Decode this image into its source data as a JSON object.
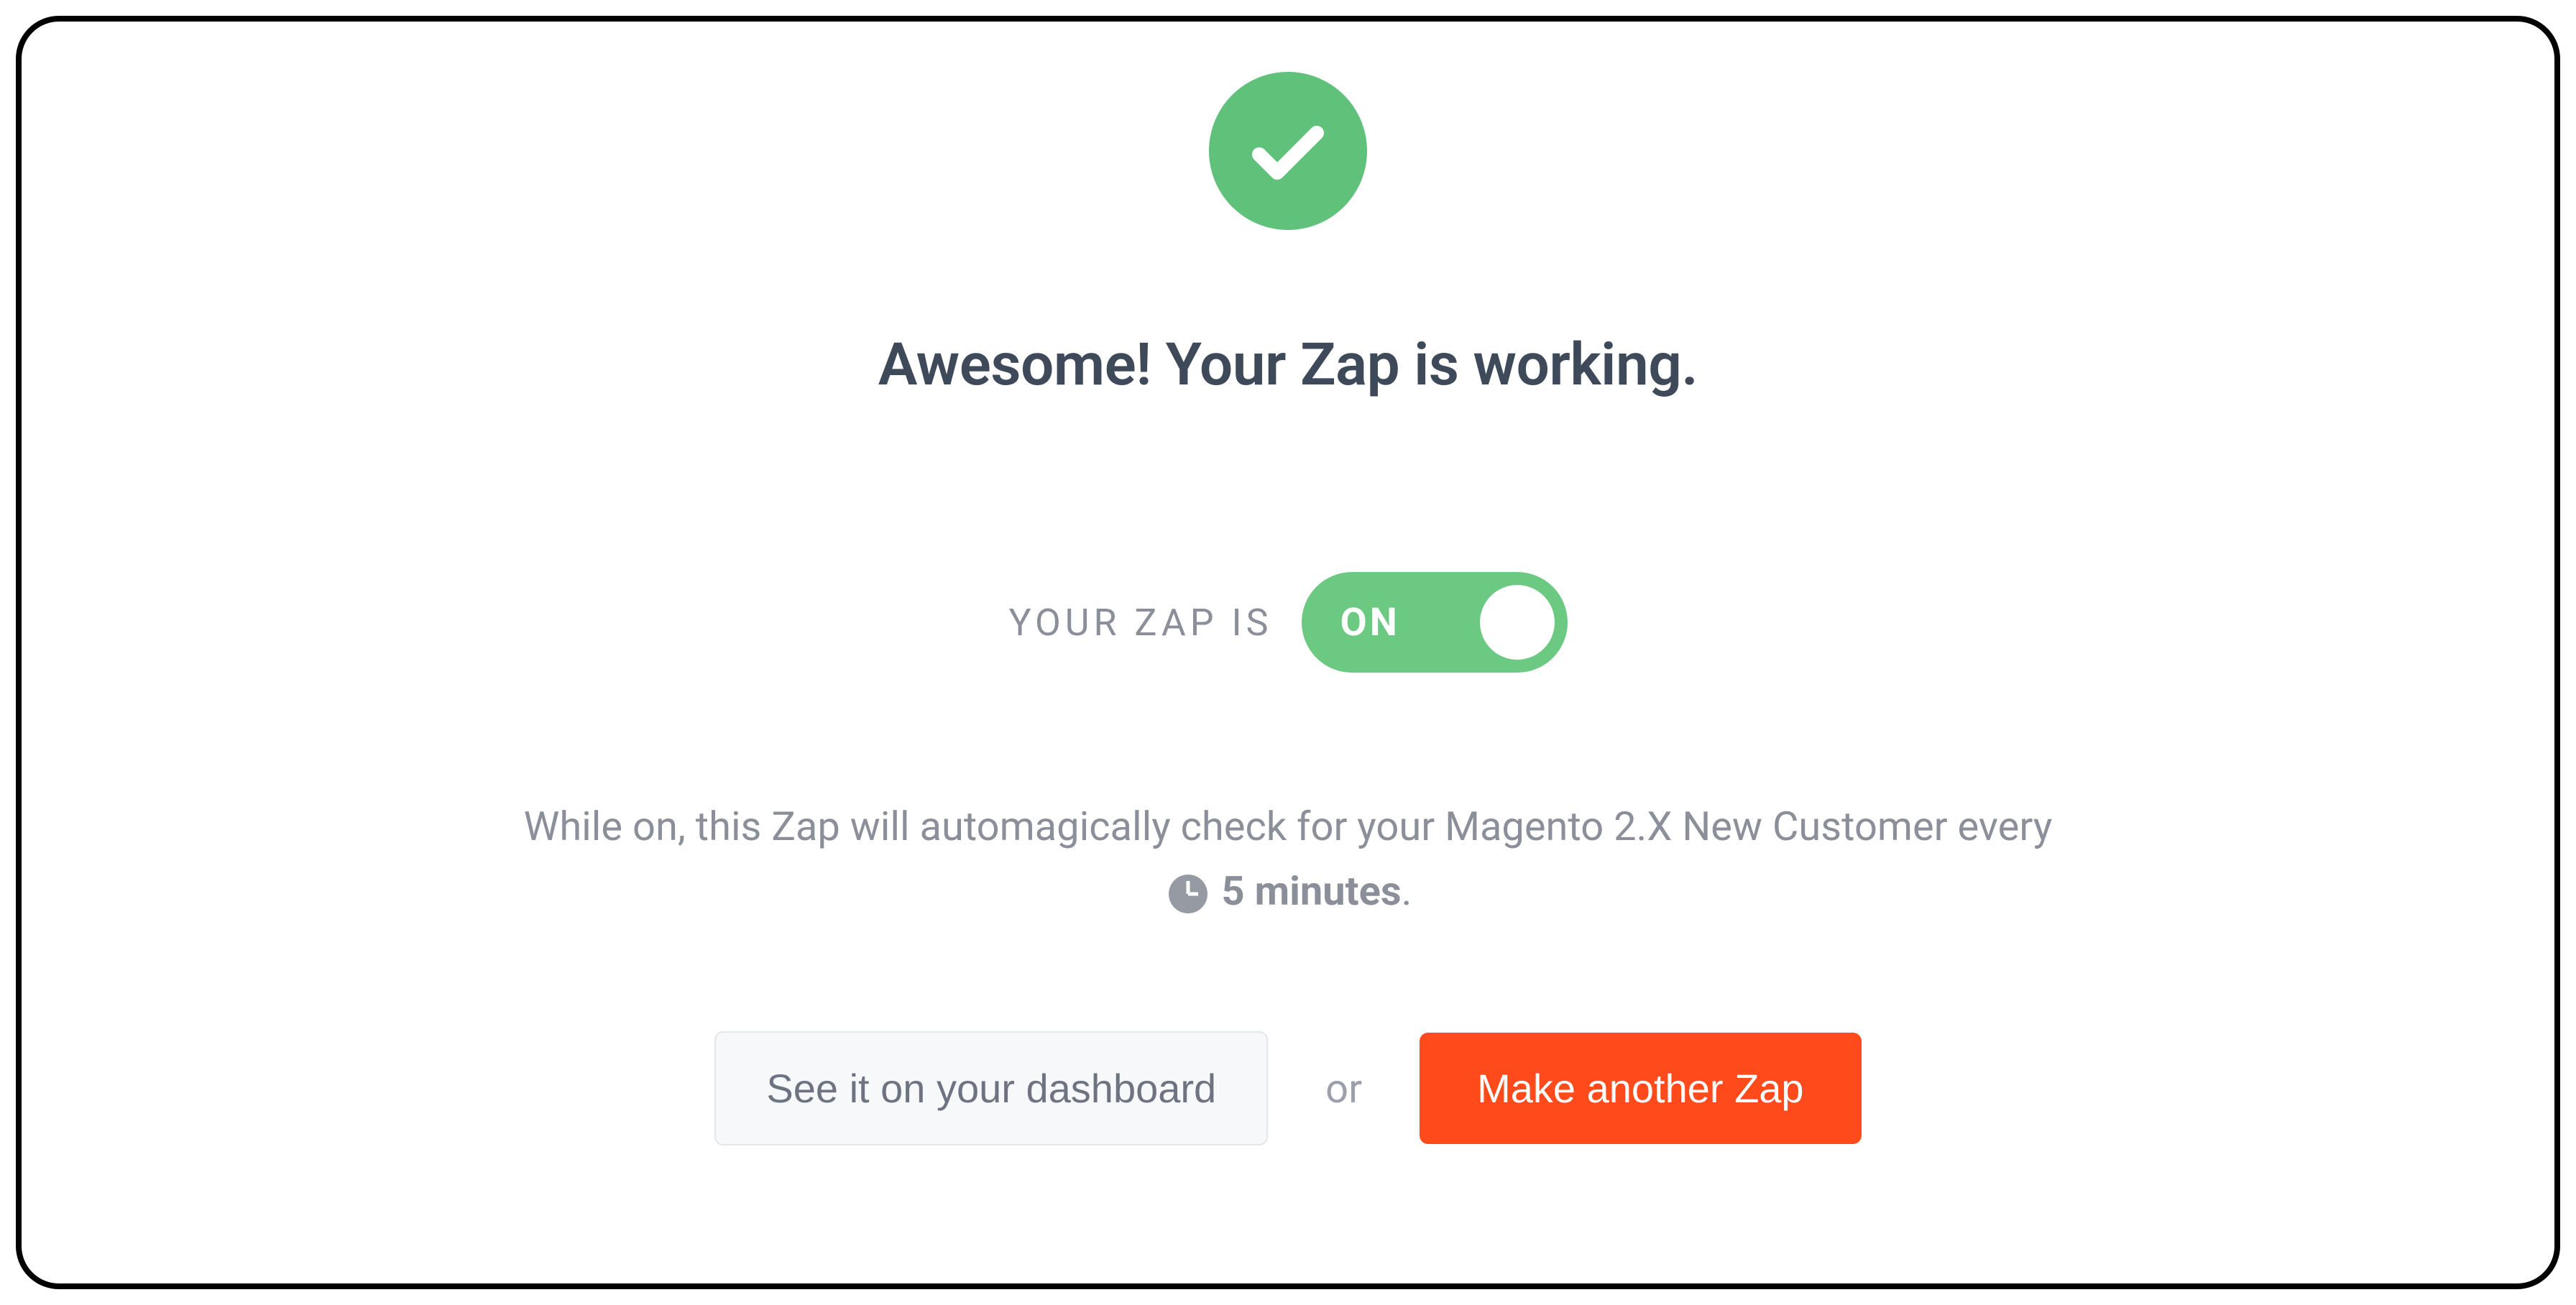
{
  "headline": "Awesome! Your Zap is working.",
  "status": {
    "label": "YOUR ZAP IS",
    "toggle_text": "ON"
  },
  "description": {
    "part1": "While on, this Zap will automagically check for your Magento 2.X New Customer every ",
    "interval": "5 minutes",
    "part2": "."
  },
  "buttons": {
    "secondary": "See it on your dashboard",
    "or": "or",
    "primary": "Make another Zap"
  }
}
